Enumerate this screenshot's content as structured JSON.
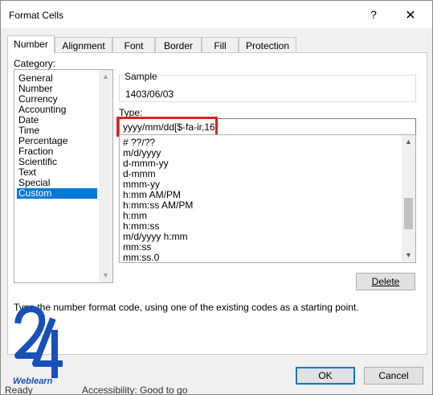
{
  "window": {
    "title": "Format Cells",
    "help_glyph": "?",
    "close_glyph": "✕"
  },
  "tabs": [
    {
      "label": "Number",
      "active": true
    },
    {
      "label": "Alignment",
      "active": false
    },
    {
      "label": "Font",
      "active": false
    },
    {
      "label": "Border",
      "active": false
    },
    {
      "label": "Fill",
      "active": false
    },
    {
      "label": "Protection",
      "active": false
    }
  ],
  "category": {
    "label": "Category:",
    "items": [
      "General",
      "Number",
      "Currency",
      "Accounting",
      "Date",
      "Time",
      "Percentage",
      "Fraction",
      "Scientific",
      "Text",
      "Special",
      "Custom"
    ],
    "selected": "Custom"
  },
  "sample": {
    "label": "Sample",
    "value": "1403/06/03"
  },
  "type": {
    "label": "Type:",
    "value": "yyyy/mm/dd[$-fa-ir,16]",
    "highlight_color": "#d9231c",
    "formats": [
      "# ??/??",
      "m/d/yyyy",
      "d-mmm-yy",
      "d-mmm",
      "mmm-yy",
      "h:mm AM/PM",
      "h:mm:ss AM/PM",
      "h:mm",
      "h:mm:ss",
      "m/d/yyyy h:mm",
      "mm:ss",
      "mm:ss.0"
    ]
  },
  "buttons": {
    "delete": "Delete",
    "ok": "OK",
    "cancel": "Cancel"
  },
  "hint": "Type the number format code, using one of the existing codes as a starting point.",
  "logo": {
    "number": "24",
    "word": "Weblearn",
    "color": "#1a4fb8"
  },
  "statusbar": {
    "left": "Ready",
    "middle": "Accessibility: Good to go"
  },
  "colors": {
    "selection": "#0078d7",
    "accent": "#0078d7"
  }
}
